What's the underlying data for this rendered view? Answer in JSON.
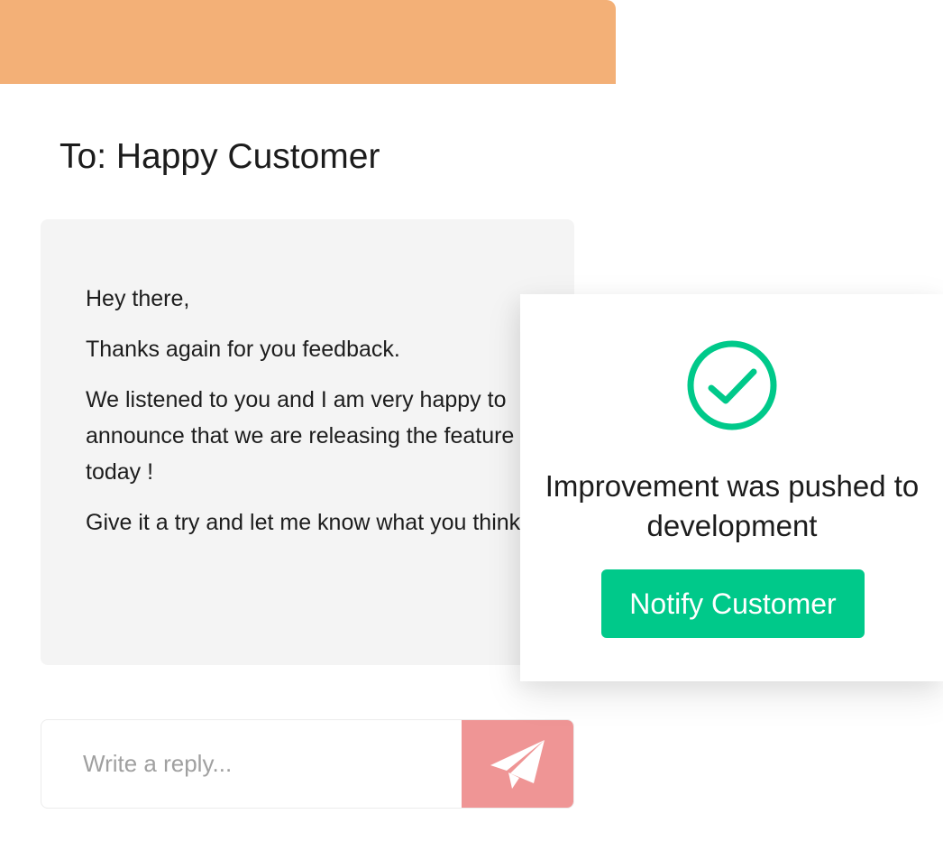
{
  "compose": {
    "recipient_label": "To: Happy Customer",
    "message": {
      "paragraphs": [
        "Hey there,",
        "Thanks again for you feedback.",
        "We listened to you and I am very happy to announce that we are releasing the feature today !",
        "Give it a try and let me know what you think."
      ]
    },
    "reply": {
      "placeholder": "Write a reply...",
      "send_icon": "paper-plane-icon"
    }
  },
  "notification": {
    "icon": "check-circle-icon",
    "message": "Improvement was pushed to development",
    "button_label": "Notify Customer"
  },
  "colors": {
    "header": "#f3b077",
    "message_bg": "#f4f4f4",
    "send_button": "#ef9595",
    "success": "#00c98a"
  }
}
